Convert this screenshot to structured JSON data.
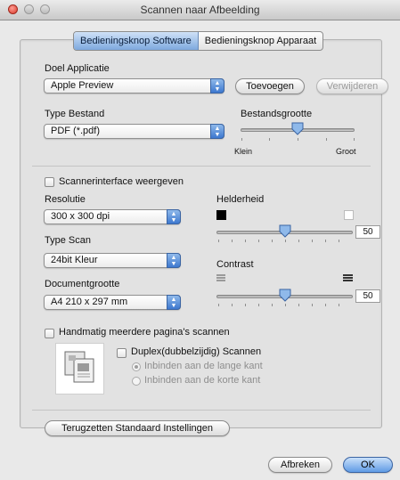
{
  "window": {
    "title": "Scannen naar Afbeelding"
  },
  "tabs": [
    {
      "label": "Bedieningsknop Software",
      "selected": true
    },
    {
      "label": "Bedieningsknop Apparaat",
      "selected": false
    }
  ],
  "target_app": {
    "label": "Doel Applicatie",
    "value": "Apple Preview",
    "add_button": "Toevoegen",
    "remove_button": "Verwijderen"
  },
  "file_type": {
    "label": "Type Bestand",
    "value": "PDF (*.pdf)"
  },
  "file_size": {
    "label": "Bestandsgrootte",
    "min_label": "Klein",
    "max_label": "Groot",
    "level": 0.5
  },
  "scanner_interface": {
    "label": "Scannerinterface weergeven",
    "checked": false
  },
  "resolution": {
    "label": "Resolutie",
    "value": "300 x 300 dpi"
  },
  "scan_type": {
    "label": "Type Scan",
    "value": "24bit Kleur"
  },
  "document_size": {
    "label": "Documentgrootte",
    "value": "A4  210 x 297 mm"
  },
  "brightness": {
    "label": "Helderheid",
    "value": "50"
  },
  "contrast": {
    "label": "Contrast",
    "value": "50"
  },
  "manual_multipage": {
    "label": "Handmatig meerdere pagina's scannen",
    "checked": false
  },
  "duplex": {
    "label": "Duplex(dubbelzijdig) Scannen",
    "checked": false,
    "options": [
      "Inbinden aan de lange kant",
      "Inbinden aan de korte kant"
    ],
    "selected_index": 0
  },
  "restore_defaults_button": "Terugzetten Standaard Instellingen",
  "cancel_button": "Afbreken",
  "ok_button": "OK",
  "colors": {
    "accent": "#5f9be5",
    "close": "#d8392b"
  }
}
